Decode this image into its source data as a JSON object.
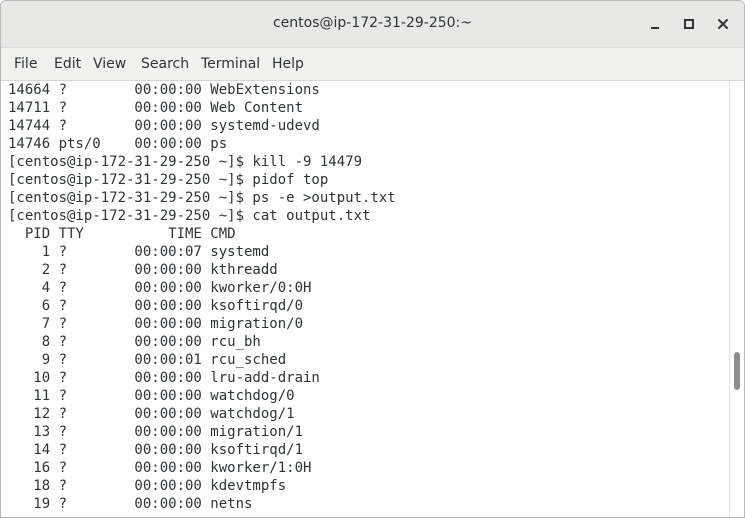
{
  "window": {
    "title": "centos@ip-172-31-29-250:~"
  },
  "controls": {
    "minimize_icon": "minimize-icon",
    "maximize_icon": "maximize-icon",
    "close_icon": "close-icon"
  },
  "menu": {
    "items": [
      "File",
      "Edit",
      "View",
      "Search",
      "Terminal",
      "Help"
    ]
  },
  "terminal": {
    "lines": [
      "14664 ?        00:00:00 WebExtensions",
      "14711 ?        00:00:00 Web Content",
      "14744 ?        00:00:00 systemd-udevd",
      "14746 pts/0    00:00:00 ps",
      "[centos@ip-172-31-29-250 ~]$ kill -9 14479",
      "[centos@ip-172-31-29-250 ~]$ pidof top",
      "[centos@ip-172-31-29-250 ~]$ ps -e >output.txt",
      "[centos@ip-172-31-29-250 ~]$ cat output.txt",
      "  PID TTY          TIME CMD",
      "    1 ?        00:00:07 systemd",
      "    2 ?        00:00:00 kthreadd",
      "    4 ?        00:00:00 kworker/0:0H",
      "    6 ?        00:00:00 ksoftirqd/0",
      "    7 ?        00:00:00 migration/0",
      "    8 ?        00:00:00 rcu_bh",
      "    9 ?        00:00:01 rcu_sched",
      "   10 ?        00:00:00 lru-add-drain",
      "   11 ?        00:00:00 watchdog/0",
      "   12 ?        00:00:00 watchdog/1",
      "   13 ?        00:00:00 migration/1",
      "   14 ?        00:00:00 ksoftirqd/1",
      "   16 ?        00:00:00 kworker/1:0H",
      "   18 ?        00:00:00 kdevtmpfs",
      "   19 ?        00:00:00 netns"
    ]
  },
  "scrollbar": {
    "position_fraction": 0.68
  }
}
